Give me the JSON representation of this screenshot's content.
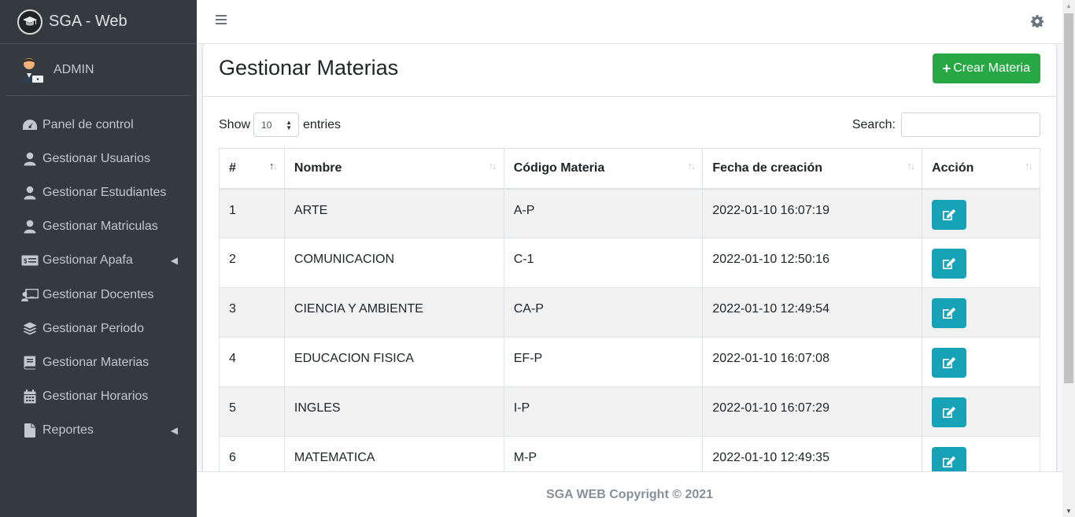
{
  "brand": {
    "title": "SGA - Web"
  },
  "user": {
    "name": "ADMIN"
  },
  "sidebar": {
    "items": [
      {
        "label": "Panel de control",
        "icon": "tachometer-icon"
      },
      {
        "label": "Gestionar Usuarios",
        "icon": "user-icon"
      },
      {
        "label": "Gestionar Estudiantes",
        "icon": "user-icon"
      },
      {
        "label": "Gestionar Matriculas",
        "icon": "user-icon"
      },
      {
        "label": "Gestionar Apafa",
        "icon": "money-bill-icon",
        "has_submenu": true
      },
      {
        "label": "Gestionar Docentes",
        "icon": "chalkboard-teacher-icon"
      },
      {
        "label": "Gestionar Periodo",
        "icon": "layers-icon"
      },
      {
        "label": "Gestionar Materias",
        "icon": "book-icon"
      },
      {
        "label": "Gestionar Horarios",
        "icon": "calendar-icon"
      },
      {
        "label": "Reportes",
        "icon": "file-icon",
        "has_submenu": true
      }
    ]
  },
  "page": {
    "title": "Gestionar Materias",
    "create_button": "Crear Materia"
  },
  "table_controls": {
    "show_label": "Show",
    "entries_value": "10",
    "entries_label": "entries",
    "search_label": "Search:",
    "search_value": ""
  },
  "table": {
    "columns": [
      "#",
      "Nombre",
      "Código Materia",
      "Fecha de creación",
      "Acción"
    ],
    "rows": [
      {
        "num": "1",
        "nombre": "ARTE",
        "codigo": "A-P",
        "fecha": "2022-01-10 16:07:19"
      },
      {
        "num": "2",
        "nombre": "COMUNICACION",
        "codigo": "C-1",
        "fecha": "2022-01-10 12:50:16"
      },
      {
        "num": "3",
        "nombre": "CIENCIA Y AMBIENTE",
        "codigo": "CA-P",
        "fecha": "2022-01-10 12:49:54"
      },
      {
        "num": "4",
        "nombre": "EDUCACION FISICA",
        "codigo": "EF-P",
        "fecha": "2022-01-10 16:07:08"
      },
      {
        "num": "5",
        "nombre": "INGLES",
        "codigo": "I-P",
        "fecha": "2022-01-10 16:07:29"
      },
      {
        "num": "6",
        "nombre": "MATEMATICA",
        "codigo": "M-P",
        "fecha": "2022-01-10 12:49:35"
      }
    ]
  },
  "footer": {
    "text": "SGA WEB Copyright © 2021"
  },
  "colors": {
    "sidebar_bg": "#343a40",
    "create_button": "#28a745",
    "edit_button": "#17a2b8",
    "footer_text": "#869099"
  }
}
